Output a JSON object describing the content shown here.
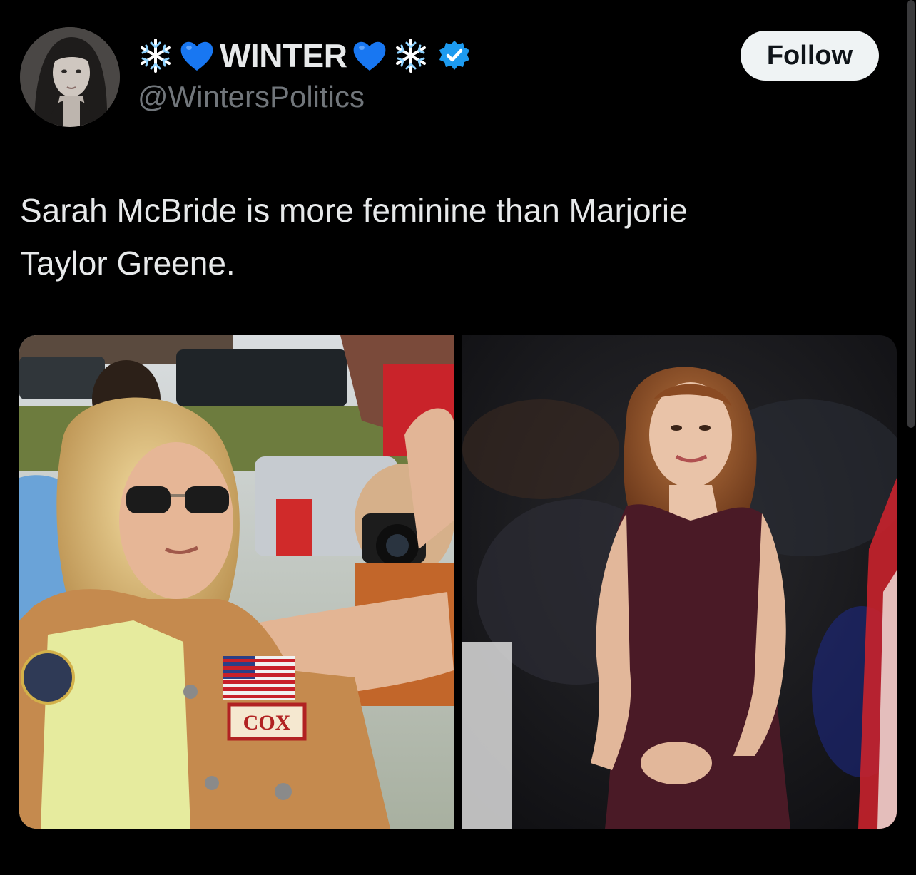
{
  "tweet": {
    "author": {
      "name_prefix_icons": [
        "snowflake-emoji",
        "blue-heart-emoji"
      ],
      "name": "WINTER",
      "name_suffix_icons": [
        "blue-heart-emoji",
        "snowflake-emoji"
      ],
      "handle": "@WintersPolitics",
      "verified": true,
      "avatar_icon": "profile-photo"
    },
    "follow_label": "Follow",
    "text_line1": "Sarah McBride is more feminine than Marjorie",
    "text_line2": "Taylor Greene.",
    "media": {
      "left_photo": {
        "description_icon": "photo-left",
        "patch_text": "COX"
      },
      "right_photo": {
        "description_icon": "photo-right"
      }
    }
  },
  "colors": {
    "background": "#000000",
    "primary_text": "#e7e9ea",
    "secondary_text": "#71767b",
    "follow_bg": "#eff3f4",
    "verified_blue": "#1d9bf0",
    "heart_blue": "#1877f2"
  }
}
